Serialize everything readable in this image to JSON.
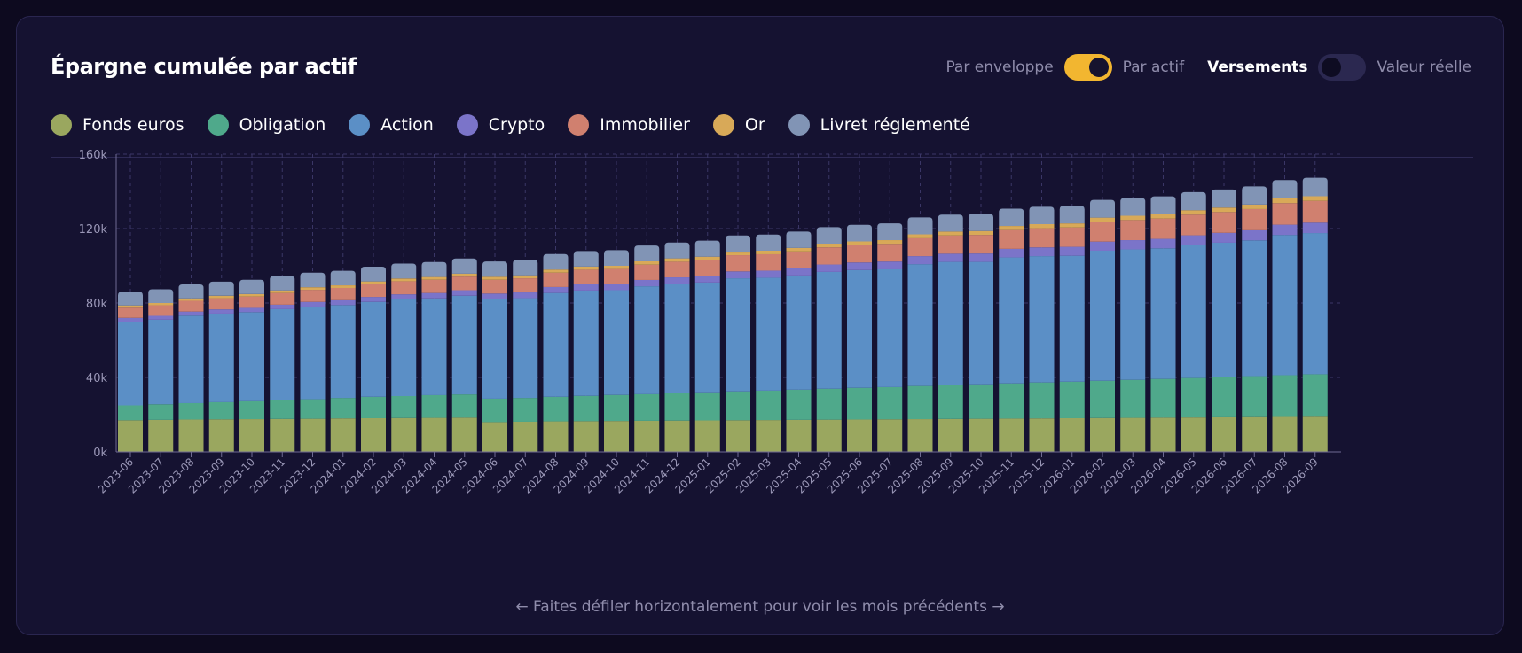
{
  "header": {
    "title": "Épargne cumulée par actif",
    "mode_left_label": "Par enveloppe",
    "mode_right_label": "Par actif",
    "value_left_label": "Versements",
    "value_right_label": "Valeur réelle"
  },
  "legend": [
    {
      "name": "Fonds euros",
      "color": "#9aa75f"
    },
    {
      "name": "Obligation",
      "color": "#4fa98b"
    },
    {
      "name": "Action",
      "color": "#5b8fc6"
    },
    {
      "name": "Crypto",
      "color": "#7b74c9"
    },
    {
      "name": "Immobilier",
      "color": "#d0806f"
    },
    {
      "name": "Or",
      "color": "#d8a958"
    },
    {
      "name": "Livret réglementé",
      "color": "#8194b5"
    }
  ],
  "footer": {
    "hint": "← Faites défiler horizontalement pour voir les mois précédents →"
  },
  "chart_data": {
    "type": "bar",
    "stacked": true,
    "grid": true,
    "ylim": [
      0,
      160000
    ],
    "yticks": [
      "0k",
      "40k",
      "80k",
      "120k",
      "160k"
    ],
    "categories": [
      "2023-06",
      "2023-07",
      "2023-08",
      "2023-09",
      "2023-10",
      "2023-11",
      "2023-12",
      "2024-01",
      "2024-02",
      "2024-03",
      "2024-04",
      "2024-05",
      "2024-06",
      "2024-07",
      "2024-08",
      "2024-09",
      "2024-10",
      "2024-11",
      "2024-12",
      "2025-01",
      "2025-02",
      "2025-03",
      "2025-04",
      "2025-05",
      "2025-06",
      "2025-07",
      "2025-08",
      "2025-09",
      "2025-10",
      "2025-11",
      "2025-12",
      "2026-01",
      "2026-02",
      "2026-03",
      "2026-04",
      "2026-05",
      "2026-06",
      "2026-07",
      "2026-08",
      "2026-09"
    ],
    "series": [
      {
        "name": "Fonds euros",
        "color": "#9aa75f",
        "values": [
          17000,
          17200,
          17400,
          17500,
          17600,
          17700,
          17800,
          18000,
          18100,
          18200,
          18300,
          18400,
          16000,
          16200,
          16400,
          16500,
          16600,
          16700,
          16800,
          16900,
          17000,
          17100,
          17200,
          17300,
          17400,
          17500,
          17600,
          17700,
          17800,
          17900,
          18000,
          18100,
          18200,
          18300,
          18400,
          18500,
          18600,
          18700,
          18800,
          18900
        ]
      },
      {
        "name": "Obligation",
        "color": "#4fa98b",
        "values": [
          8000,
          8400,
          8800,
          9200,
          9600,
          10000,
          10500,
          11000,
          11500,
          11800,
          12200,
          12500,
          12600,
          12800,
          13200,
          13600,
          14000,
          14300,
          14700,
          15100,
          15500,
          15800,
          16200,
          16600,
          17000,
          17300,
          17800,
          18200,
          18500,
          18900,
          19300,
          19600,
          20000,
          20400,
          20800,
          21200,
          21600,
          22000,
          22400,
          22800
        ]
      },
      {
        "name": "Action",
        "color": "#5b8fc6",
        "values": [
          45000,
          45400,
          47000,
          47600,
          47900,
          49000,
          49800,
          49900,
          51000,
          51900,
          52000,
          53000,
          53500,
          53600,
          55800,
          56600,
          56300,
          58000,
          58800,
          59000,
          60800,
          60700,
          61400,
          62800,
          63300,
          63300,
          65500,
          66200,
          65800,
          67700,
          67900,
          67700,
          69900,
          70100,
          70200,
          71500,
          72200,
          73000,
          75400,
          75900
        ]
      },
      {
        "name": "Crypto",
        "color": "#7b74c9",
        "values": [
          2000,
          2100,
          2200,
          2300,
          2300,
          2400,
          2500,
          2600,
          2700,
          2800,
          2900,
          3000,
          3000,
          3100,
          3200,
          3300,
          3300,
          3400,
          3500,
          3600,
          3700,
          3800,
          3900,
          4000,
          4100,
          4200,
          4300,
          4400,
          4500,
          4600,
          4700,
          4800,
          4900,
          5000,
          5100,
          5200,
          5300,
          5400,
          5500,
          5600
        ]
      },
      {
        "name": "Immobilier",
        "color": "#d0806f",
        "values": [
          5500,
          5700,
          5800,
          6000,
          6100,
          6300,
          6500,
          6600,
          6800,
          7000,
          7100,
          7300,
          7400,
          7600,
          7700,
          7900,
          8100,
          8200,
          8400,
          8500,
          8700,
          8800,
          9000,
          9200,
          9300,
          9500,
          9600,
          9800,
          10000,
          10100,
          10300,
          10400,
          10600,
          10800,
          10900,
          11100,
          11200,
          11400,
          11600,
          11700
        ]
      },
      {
        "name": "Or",
        "color": "#d8a958",
        "values": [
          1200,
          1200,
          1300,
          1300,
          1300,
          1400,
          1400,
          1400,
          1500,
          1500,
          1500,
          1600,
          1600,
          1600,
          1700,
          1700,
          1700,
          1800,
          1800,
          1800,
          1900,
          1900,
          1900,
          2000,
          2000,
          2000,
          2100,
          2100,
          2100,
          2200,
          2200,
          2200,
          2300,
          2300,
          2300,
          2400,
          2400,
          2400,
          2500,
          2500
        ]
      },
      {
        "name": "Livret réglementé",
        "color": "#8194b5",
        "values": [
          7300,
          7400,
          7500,
          7600,
          7700,
          7700,
          7800,
          7800,
          7900,
          8000,
          8000,
          8100,
          8200,
          8300,
          8300,
          8300,
          8400,
          8500,
          8500,
          8600,
          8700,
          8700,
          8800,
          8900,
          8900,
          9000,
          9100,
          9100,
          9200,
          9300,
          9300,
          9400,
          9500,
          9500,
          9600,
          9700,
          9700,
          9800,
          9900,
          9900
        ]
      }
    ]
  }
}
